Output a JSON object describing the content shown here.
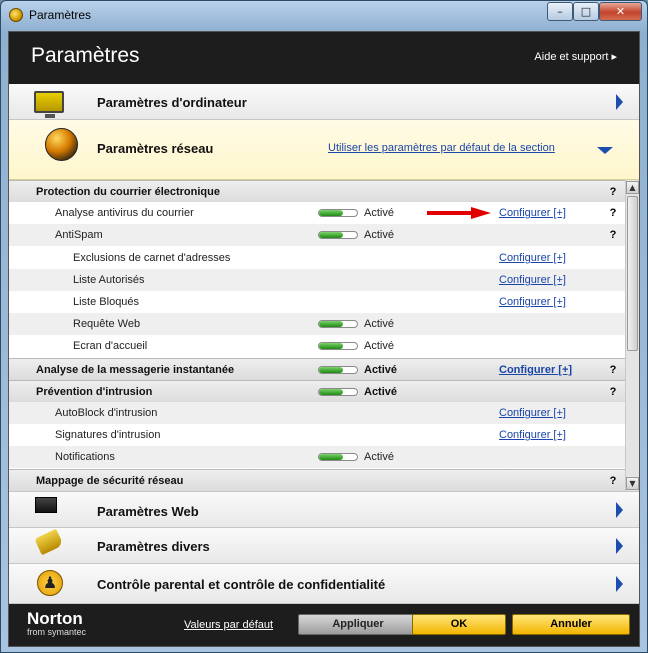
{
  "window": {
    "title": "Paramètres"
  },
  "header": {
    "title": "Paramètres",
    "help_link": "Aide et support ▸"
  },
  "categories": {
    "computer": {
      "label": "Paramètres d'ordinateur"
    },
    "network": {
      "label": "Paramètres réseau",
      "default_link": "Utiliser les paramètres par défaut de la section"
    },
    "web": {
      "label": "Paramètres Web"
    },
    "misc": {
      "label": "Paramètres divers"
    },
    "parental": {
      "label": "Contrôle parental et contrôle de confidentialité"
    }
  },
  "rows": [
    {
      "label": "Protection du courrier électronique",
      "level": 0,
      "section": true,
      "help": "?"
    },
    {
      "label": "Analyse antivirus du courrier",
      "level": 1,
      "status": "Activé",
      "on": 1.0,
      "configure": "Configurer [+]",
      "help": "?",
      "arrow": true
    },
    {
      "label": "AntiSpam",
      "level": 1,
      "status": "Activé",
      "on": 1.0,
      "help": "?"
    },
    {
      "label": "Exclusions de carnet d'adresses",
      "level": 2,
      "configure": "Configurer [+]"
    },
    {
      "label": "Liste Autorisés",
      "level": 2,
      "configure": "Configurer [+]"
    },
    {
      "label": "Liste Bloqués",
      "level": 2,
      "configure": "Configurer [+]"
    },
    {
      "label": "Requête Web",
      "level": 2,
      "status": "Activé",
      "on": 1.0
    },
    {
      "label": "Ecran d'accueil",
      "level": 2,
      "status": "Activé",
      "on": 1.0
    },
    {
      "label": "Analyse de la messagerie instantanée",
      "level": 0,
      "section": true,
      "status": "Activé",
      "on": 1.0,
      "configure": "Configurer [+]",
      "help": "?"
    },
    {
      "label": "Prévention d'intrusion",
      "level": 0,
      "section": true,
      "status": "Activé",
      "on": 1.0,
      "help": "?"
    },
    {
      "label": "AutoBlock d'intrusion",
      "level": 1,
      "configure": "Configurer [+]"
    },
    {
      "label": "Signatures d'intrusion",
      "level": 1,
      "configure": "Configurer [+]"
    },
    {
      "label": "Notifications",
      "level": 1,
      "status": "Activé",
      "on": 1.0
    },
    {
      "label": "Mappage de sécurité réseau",
      "level": 0,
      "section": true,
      "help": "?"
    }
  ],
  "footer": {
    "logo_main": "Norton",
    "logo_sub": "from symantec",
    "defaults_link": "Valeurs par défaut",
    "apply": "Appliquer",
    "ok": "OK",
    "cancel": "Annuler"
  },
  "colors": {
    "link": "#1a45a8",
    "accent": "#f3b500",
    "toggle_on": "#1e8a12"
  }
}
